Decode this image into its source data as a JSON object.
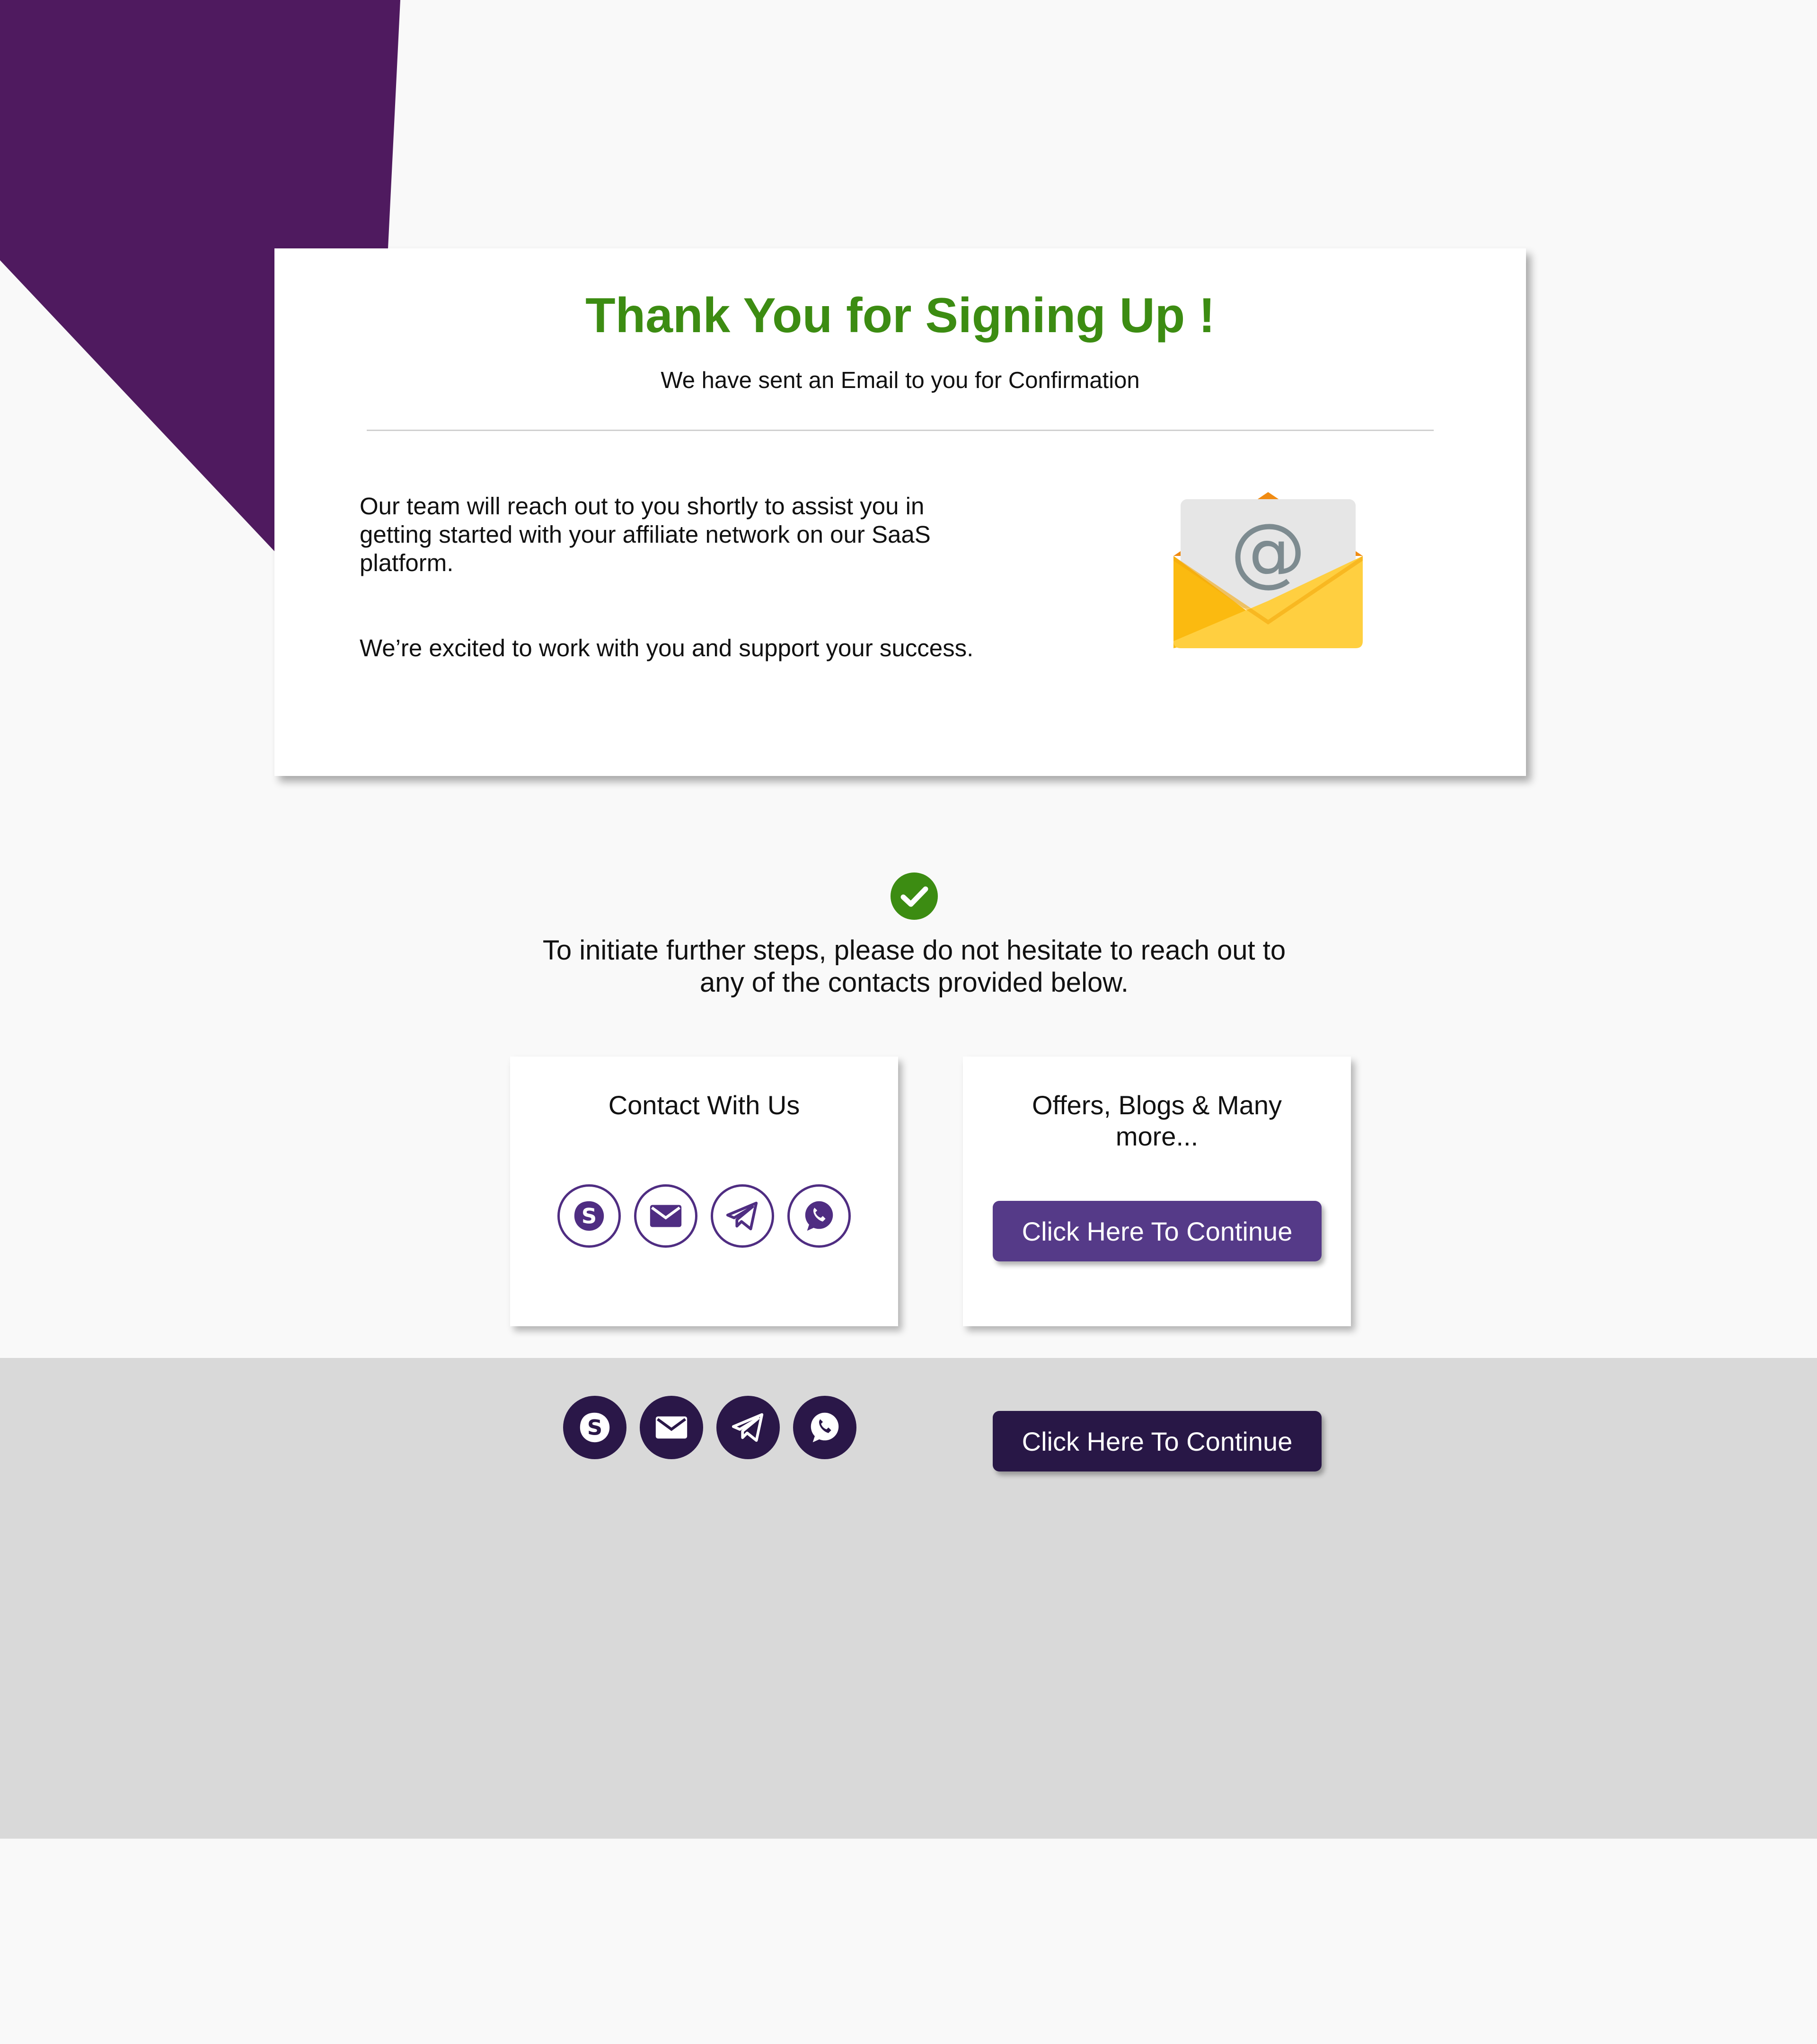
{
  "colors": {
    "brand_purple": "#4f1a5f",
    "heading_green": "#3c8c12",
    "button_purple": "#553a88",
    "button_dark": "#281746",
    "band_gray": "#d9d9d9"
  },
  "card": {
    "title": "Thank You for Signing Up !",
    "subtitle": "We have sent an Email to you for Confirmation",
    "paragraph_1": "Our team will reach out to you shortly to assist you in getting started with your affiliate network on our SaaS platform.",
    "paragraph_2": "We’re excited to work with you and support your success.",
    "illustration": "envelope-email-icon"
  },
  "middle": {
    "status_icon": "check-circle-icon",
    "message": "To initiate further steps, please do not hesitate to reach out to any of the contacts provided below."
  },
  "contact_card": {
    "title": "Contact With Us",
    "icons": [
      "skype-icon",
      "mail-icon",
      "telegram-icon",
      "whatsapp-icon"
    ]
  },
  "offers_card": {
    "title": "Offers, Blogs & Many more...",
    "button_label": "Click Here To Continue"
  },
  "footer_band": {
    "icons": [
      "skype-icon",
      "mail-icon",
      "telegram-icon",
      "whatsapp-icon"
    ],
    "button_label": "Click Here To Continue"
  }
}
